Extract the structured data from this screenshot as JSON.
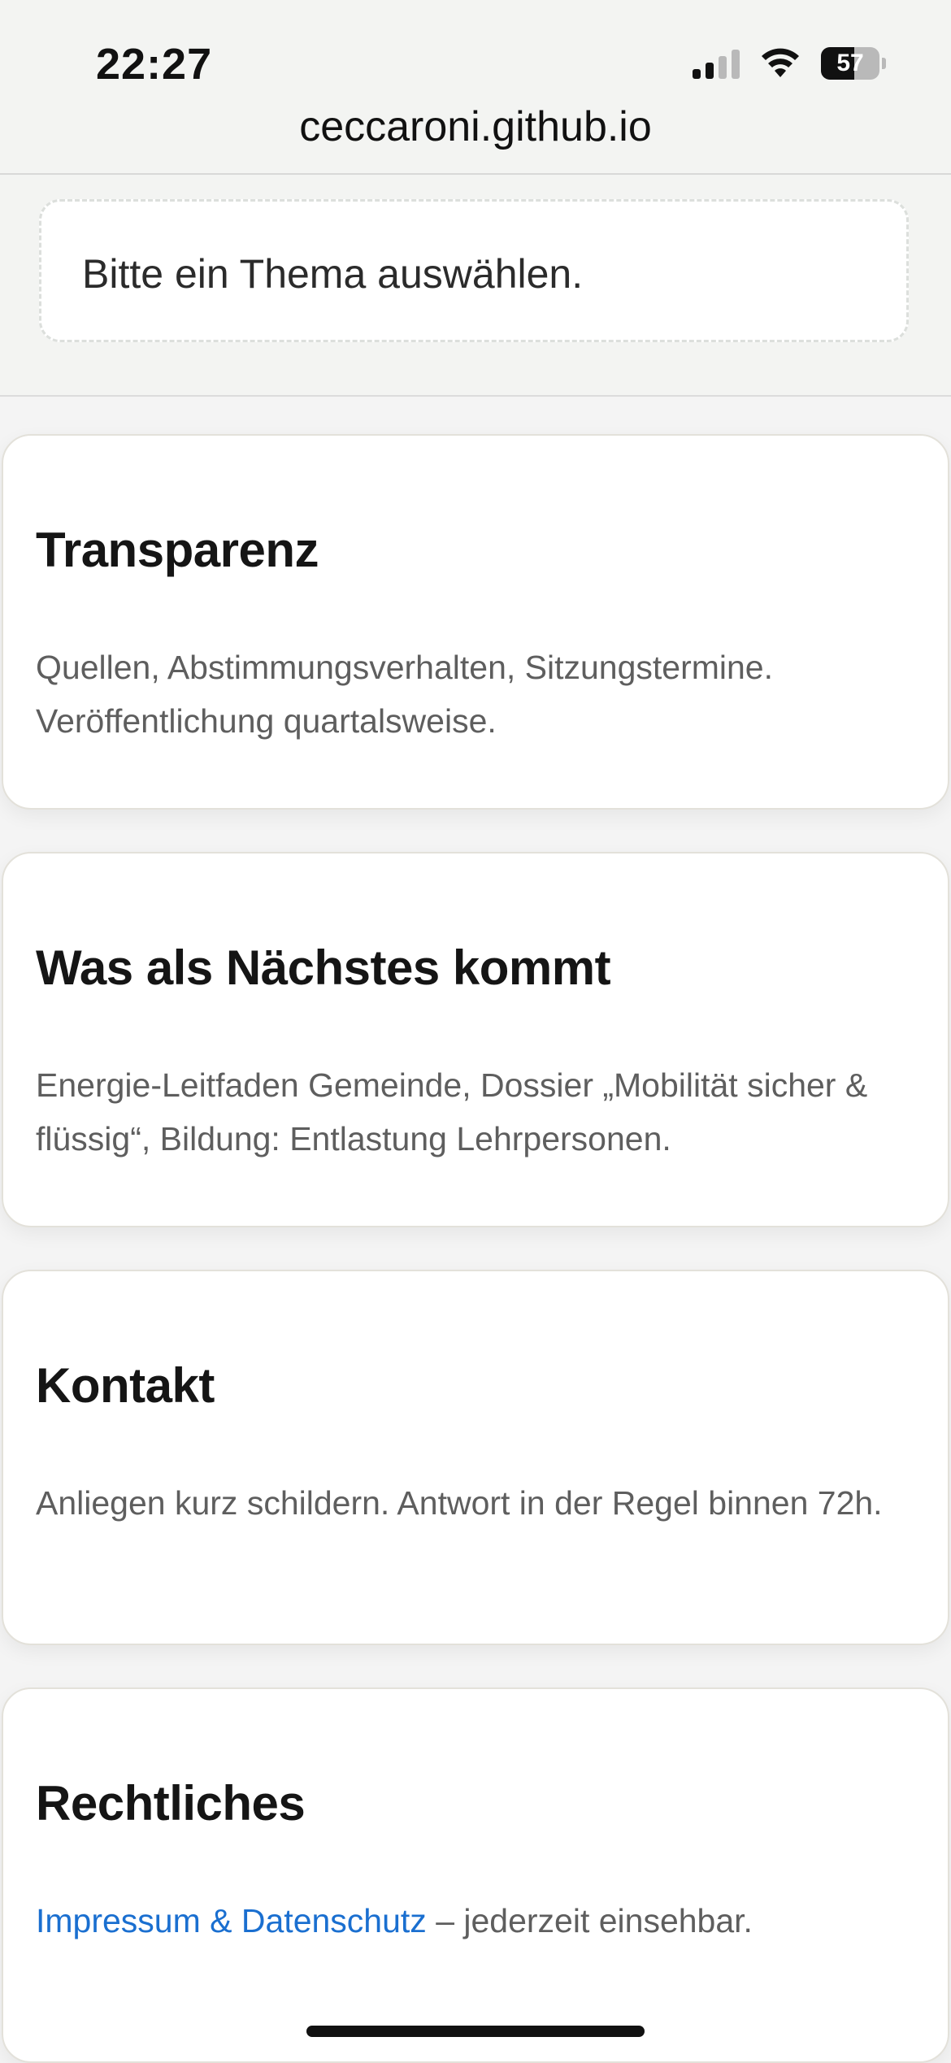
{
  "status_bar": {
    "time": "22:27",
    "battery_level": "57",
    "battery_fraction": 0.57
  },
  "browser": {
    "url": "ceccaroni.github.io"
  },
  "notice": {
    "text": "Bitte ein Thema auswählen."
  },
  "cards": [
    {
      "title": "Transparenz",
      "body": "Quellen, Abstimmungsverhalten, Sitzungstermine. Veröffentlichung quartalsweise."
    },
    {
      "title": "Was als Nächstes kommt",
      "body": "Energie-Leitfaden Gemeinde, Dossier „Mobilität sicher & flüssig“, Bildung: Entlastung Lehrpersonen."
    },
    {
      "title": "Kontakt",
      "body": "Anliegen kurz schildern. Antwort in der Regel binnen 72h."
    },
    {
      "title": "Rechtliches",
      "link_text": "Impressum & Datenschutz",
      "body_suffix": " – jederzeit einsehbar."
    }
  ],
  "colors": {
    "link": "#1a6fd0",
    "heading": "#151515",
    "body_text": "#5e5e5e",
    "top_bar_bg": "#f3f4f2"
  },
  "icons": [
    "cellular-signal-icon",
    "wifi-icon",
    "battery-icon"
  ]
}
